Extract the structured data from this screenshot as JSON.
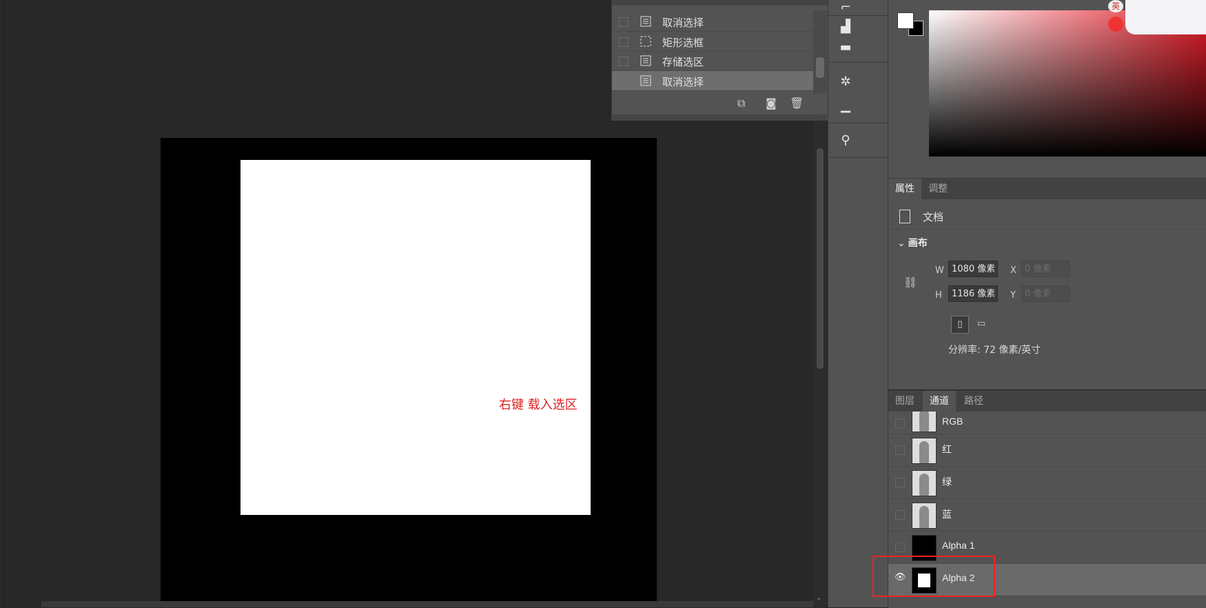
{
  "canvas": {
    "annotation": "右键 载入选区"
  },
  "history": {
    "items": [
      {
        "label": "取消选择",
        "icon": "document-icon",
        "selected": false
      },
      {
        "label": "矩形选框",
        "icon": "marquee-icon",
        "selected": false
      },
      {
        "label": "存储选区",
        "icon": "document-icon",
        "selected": false
      },
      {
        "label": "取消选择",
        "icon": "document-icon",
        "selected": true
      }
    ],
    "tools": [
      "new-snapshot-icon",
      "camera-icon",
      "trash-icon"
    ]
  },
  "colors": {
    "foreground": "#ffffff",
    "background": "#000000",
    "hue": "#e41e2a"
  },
  "sticker": {
    "badge": "英"
  },
  "properties": {
    "tabs": [
      {
        "label": "属性",
        "active": true
      },
      {
        "label": "调整",
        "active": false
      }
    ],
    "doc_label": "文档",
    "section_title": "画布",
    "w_label": "W",
    "w_value": "1080 像素",
    "h_label": "H",
    "h_value": "1186 像素",
    "x_label": "X",
    "x_placeholder": "0 像素",
    "y_label": "Y",
    "y_placeholder": "0 像素",
    "resolution": "分辨率: 72 像素/英寸"
  },
  "channels": {
    "tabs": [
      {
        "label": "图层",
        "active": false
      },
      {
        "label": "通道",
        "active": true
      },
      {
        "label": "路径",
        "active": false
      }
    ],
    "rows": [
      {
        "label": "RGB",
        "visible": false
      },
      {
        "label": "红",
        "visible": false
      },
      {
        "label": "绿",
        "visible": false
      },
      {
        "label": "蓝",
        "visible": false
      },
      {
        "label": "Alpha 1",
        "visible": false
      },
      {
        "label": "Alpha 2",
        "visible": true,
        "selected": true
      }
    ]
  }
}
